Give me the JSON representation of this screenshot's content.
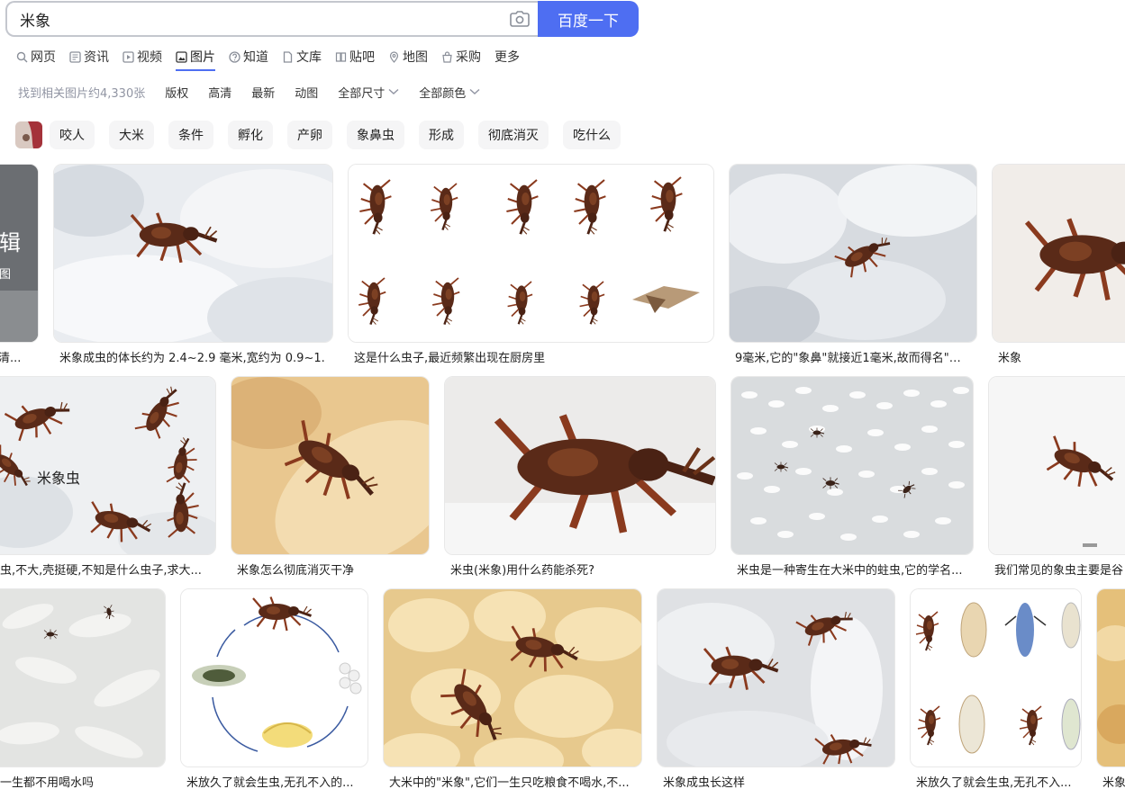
{
  "search": {
    "query": "米象",
    "button_label": "百度一下"
  },
  "tabs": [
    {
      "label": "网页",
      "icon": "search-icon"
    },
    {
      "label": "资讯",
      "icon": "news-icon"
    },
    {
      "label": "视频",
      "icon": "video-icon"
    },
    {
      "label": "图片",
      "icon": "image-icon",
      "active": true
    },
    {
      "label": "知道",
      "icon": "question-icon"
    },
    {
      "label": "文库",
      "icon": "document-icon"
    },
    {
      "label": "贴吧",
      "icon": "tieba-icon"
    },
    {
      "label": "地图",
      "icon": "map-pin-icon"
    },
    {
      "label": "采购",
      "icon": "shopping-icon"
    },
    {
      "label": "更多",
      "icon": ""
    }
  ],
  "filters": {
    "result_count": "找到相关图片约4,330张",
    "items": [
      "版权",
      "高清",
      "最新",
      "动图"
    ],
    "dropdowns": [
      "全部尺寸",
      "全部颜色"
    ]
  },
  "related_tags": [
    "咬人",
    "大米",
    "条件",
    "孵化",
    "产卵",
    "象鼻虫",
    "形成",
    "彻底消灭",
    "吃什么"
  ],
  "overlay_texts": {
    "partial_title": "辑",
    "partial_sub": "图",
    "label_rice_weevil": "米象虫"
  },
  "captions": {
    "r1": [
      "清...",
      "米象成虫的体长约为 2.4~2.9 毫米,宽约为 0.9~1.",
      "这是什么虫子,最近频繁出现在厨房里",
      "9毫米,它的\"象鼻\"就接近1毫米,故而得名\"米...",
      "米象"
    ],
    "r2": [
      "虫,不大,壳挺硬,不知是什么虫子,求大...",
      "米象怎么彻底消灭干净",
      "米虫(米象)用什么药能杀死?",
      "米虫是一种寄生在大米中的蛀虫,它的学名...",
      "我们常见的象虫主要是谷"
    ],
    "r3": [
      "一生都不用喝水吗",
      "米放久了就会生虫,无孔不入的...",
      "大米中的\"米象\",它们一生只吃粮食不喝水,不...",
      "米象成虫长这样",
      "米放久了就会生虫,无孔不入...",
      "米象"
    ]
  },
  "colors": {
    "accent": "#4e6ef2",
    "tag_bg": "#f5f5f6",
    "muted": "#9195a3"
  }
}
